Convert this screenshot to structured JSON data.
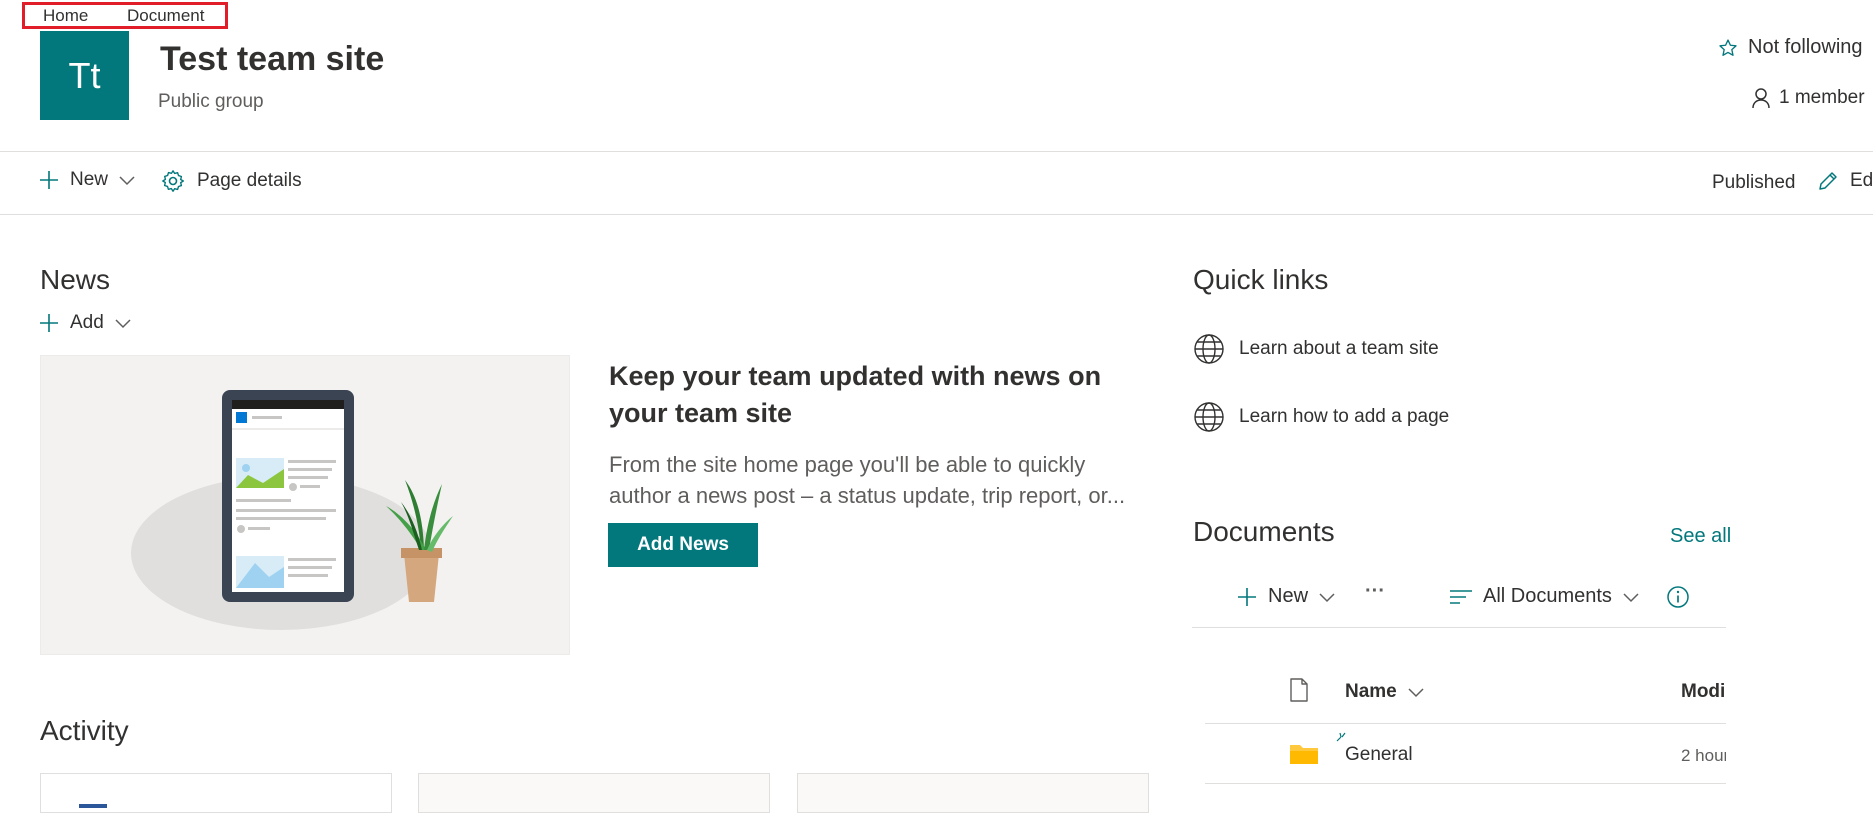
{
  "top_nav": {
    "items": [
      "Home",
      "Document"
    ]
  },
  "site": {
    "logo_text": "Tt",
    "title": "Test team site",
    "subtitle": "Public group",
    "follow_label": "Not following",
    "members_label": "1 member"
  },
  "command_bar": {
    "new_label": "New",
    "page_details_label": "Page details",
    "status": "Published",
    "edit_label": "Ed"
  },
  "news": {
    "title": "News",
    "add_label": "Add",
    "heading": "Keep your team updated with news on your team site",
    "description_line1": "From the site home page you'll be able to quickly",
    "description_line2": "author a news post – a status update, trip report, or...",
    "button_label": "Add News"
  },
  "activity": {
    "title": "Activity"
  },
  "quick_links": {
    "title": "Quick links",
    "items": [
      "Learn about a team site",
      "Learn how to add a page"
    ]
  },
  "documents": {
    "title": "Documents",
    "see_all": "See all",
    "new_label": "New",
    "more_label": "···",
    "view_label": "All Documents",
    "columns": {
      "name": "Name",
      "modified": "Modi"
    },
    "rows": [
      {
        "name": "General",
        "modified": "2 hour"
      }
    ]
  },
  "colors": {
    "accent": "#03787c",
    "highlight_box": "#e11d2a",
    "folder": "#ffc83d"
  }
}
